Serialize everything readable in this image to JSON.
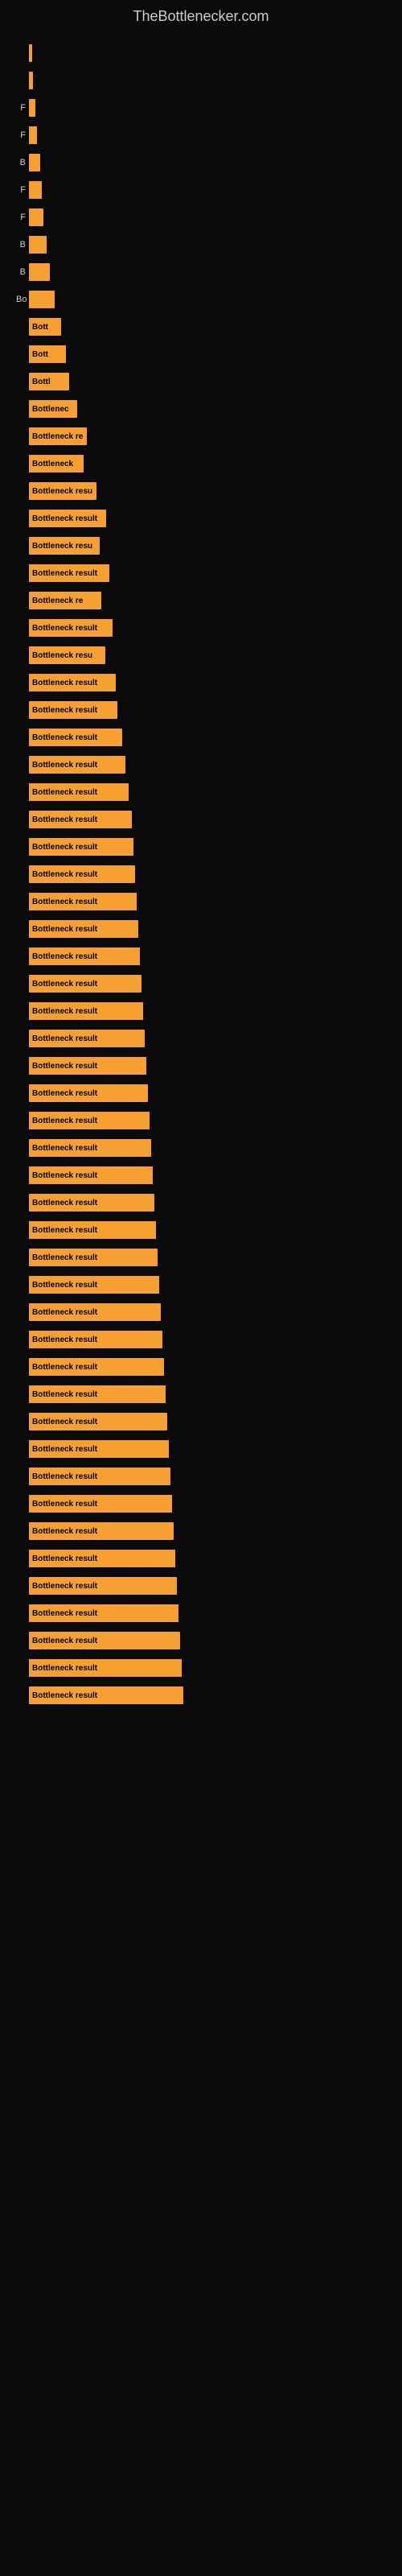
{
  "site": {
    "title": "TheBottlenecker.com"
  },
  "bars": [
    {
      "label": "",
      "width": 4,
      "text": "",
      "top_spacing": 30
    },
    {
      "label": "",
      "width": 5,
      "text": "",
      "top_spacing": 30
    },
    {
      "label": "F",
      "width": 8,
      "text": "",
      "top_spacing": 28
    },
    {
      "label": "F",
      "width": 10,
      "text": "",
      "top_spacing": 28
    },
    {
      "label": "B",
      "width": 14,
      "text": "",
      "top_spacing": 26
    },
    {
      "label": "F",
      "width": 16,
      "text": "",
      "top_spacing": 26
    },
    {
      "label": "F",
      "width": 18,
      "text": "",
      "top_spacing": 26
    },
    {
      "label": "B",
      "width": 22,
      "text": "",
      "top_spacing": 26
    },
    {
      "label": "B",
      "width": 26,
      "text": "",
      "top_spacing": 26
    },
    {
      "label": "Bo",
      "width": 32,
      "text": "",
      "top_spacing": 26
    },
    {
      "label": "",
      "width": 40,
      "text": "Bott",
      "top_spacing": 26
    },
    {
      "label": "",
      "width": 46,
      "text": "Bott",
      "top_spacing": 26
    },
    {
      "label": "",
      "width": 50,
      "text": "Bottl",
      "top_spacing": 26
    },
    {
      "label": "",
      "width": 60,
      "text": "Bottlenec",
      "top_spacing": 26
    },
    {
      "label": "",
      "width": 72,
      "text": "Bottleneck re",
      "top_spacing": 26
    },
    {
      "label": "",
      "width": 68,
      "text": "Bottleneck",
      "top_spacing": 26
    },
    {
      "label": "",
      "width": 84,
      "text": "Bottleneck resu",
      "top_spacing": 26
    },
    {
      "label": "",
      "width": 96,
      "text": "Bottleneck result",
      "top_spacing": 26
    },
    {
      "label": "",
      "width": 88,
      "text": "Bottleneck resu",
      "top_spacing": 26
    },
    {
      "label": "",
      "width": 100,
      "text": "Bottleneck result",
      "top_spacing": 26
    },
    {
      "label": "",
      "width": 90,
      "text": "Bottleneck re",
      "top_spacing": 26
    },
    {
      "label": "",
      "width": 104,
      "text": "Bottleneck result",
      "top_spacing": 26
    },
    {
      "label": "",
      "width": 95,
      "text": "Bottleneck resu",
      "top_spacing": 26
    },
    {
      "label": "",
      "width": 108,
      "text": "Bottleneck result",
      "top_spacing": 26
    },
    {
      "label": "",
      "width": 110,
      "text": "Bottleneck result",
      "top_spacing": 26
    },
    {
      "label": "",
      "width": 116,
      "text": "Bottleneck result",
      "top_spacing": 26
    },
    {
      "label": "",
      "width": 120,
      "text": "Bottleneck result",
      "top_spacing": 26
    },
    {
      "label": "",
      "width": 124,
      "text": "Bottleneck result",
      "top_spacing": 26
    },
    {
      "label": "",
      "width": 128,
      "text": "Bottleneck result",
      "top_spacing": 26
    },
    {
      "label": "",
      "width": 130,
      "text": "Bottleneck result",
      "top_spacing": 26
    },
    {
      "label": "",
      "width": 132,
      "text": "Bottleneck result",
      "top_spacing": 26
    },
    {
      "label": "",
      "width": 134,
      "text": "Bottleneck result",
      "top_spacing": 26
    },
    {
      "label": "",
      "width": 136,
      "text": "Bottleneck result",
      "top_spacing": 26
    },
    {
      "label": "",
      "width": 138,
      "text": "Bottleneck result",
      "top_spacing": 26
    },
    {
      "label": "",
      "width": 140,
      "text": "Bottleneck result",
      "top_spacing": 26
    },
    {
      "label": "",
      "width": 142,
      "text": "Bottleneck result",
      "top_spacing": 26
    },
    {
      "label": "",
      "width": 144,
      "text": "Bottleneck result",
      "top_spacing": 26
    },
    {
      "label": "",
      "width": 146,
      "text": "Bottleneck result",
      "top_spacing": 26
    },
    {
      "label": "",
      "width": 148,
      "text": "Bottleneck result",
      "top_spacing": 26
    },
    {
      "label": "",
      "width": 150,
      "text": "Bottleneck result",
      "top_spacing": 26
    },
    {
      "label": "",
      "width": 152,
      "text": "Bottleneck result",
      "top_spacing": 26
    },
    {
      "label": "",
      "width": 154,
      "text": "Bottleneck result",
      "top_spacing": 26
    },
    {
      "label": "",
      "width": 156,
      "text": "Bottleneck result",
      "top_spacing": 26
    },
    {
      "label": "",
      "width": 158,
      "text": "Bottleneck result",
      "top_spacing": 26
    },
    {
      "label": "",
      "width": 160,
      "text": "Bottleneck result",
      "top_spacing": 26
    },
    {
      "label": "",
      "width": 162,
      "text": "Bottleneck result",
      "top_spacing": 26
    },
    {
      "label": "",
      "width": 164,
      "text": "Bottleneck result",
      "top_spacing": 26
    },
    {
      "label": "",
      "width": 166,
      "text": "Bottleneck result",
      "top_spacing": 26
    },
    {
      "label": "",
      "width": 168,
      "text": "Bottleneck result",
      "top_spacing": 26
    },
    {
      "label": "",
      "width": 170,
      "text": "Bottleneck result",
      "top_spacing": 26
    },
    {
      "label": "",
      "width": 172,
      "text": "Bottleneck result",
      "top_spacing": 26
    },
    {
      "label": "",
      "width": 174,
      "text": "Bottleneck result",
      "top_spacing": 26
    },
    {
      "label": "",
      "width": 176,
      "text": "Bottleneck result",
      "top_spacing": 26
    },
    {
      "label": "",
      "width": 178,
      "text": "Bottleneck result",
      "top_spacing": 26
    },
    {
      "label": "",
      "width": 180,
      "text": "Bottleneck result",
      "top_spacing": 26
    },
    {
      "label": "",
      "width": 182,
      "text": "Bottleneck result",
      "top_spacing": 26
    },
    {
      "label": "",
      "width": 184,
      "text": "Bottleneck result",
      "top_spacing": 26
    },
    {
      "label": "",
      "width": 186,
      "text": "Bottleneck result",
      "top_spacing": 26
    },
    {
      "label": "",
      "width": 188,
      "text": "Bottleneck result",
      "top_spacing": 26
    },
    {
      "label": "",
      "width": 190,
      "text": "Bottleneck result",
      "top_spacing": 26
    },
    {
      "label": "",
      "width": 192,
      "text": "Bottleneck result",
      "top_spacing": 26
    }
  ]
}
